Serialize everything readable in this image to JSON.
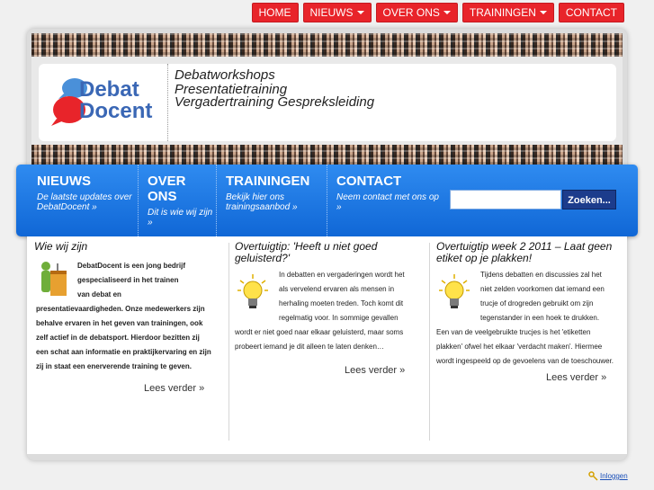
{
  "topnav": {
    "items": [
      {
        "label": "HOME",
        "caret": false
      },
      {
        "label": "NIEUWS",
        "caret": true
      },
      {
        "label": "OVER ONS",
        "caret": true
      },
      {
        "label": "TRAININGEN",
        "caret": true
      },
      {
        "label": "CONTACT",
        "caret": false
      }
    ]
  },
  "header": {
    "logo_word1": "Debat",
    "logo_word2": "Docent",
    "tagline": [
      "Debatworkshops",
      "Presentatietraining",
      "Vergadertraining Gespreksleiding"
    ]
  },
  "bluebar": {
    "items": [
      {
        "title": "NIEUWS",
        "sub": "De laatste updates over DebatDocent »"
      },
      {
        "title": "OVER ONS",
        "sub": "Dit is wie wij zijn »"
      },
      {
        "title": "TRAININGEN",
        "sub": "Bekijk hier ons trainingsaanbod »"
      },
      {
        "title": "CONTACT",
        "sub": "Neem contact met ons op »"
      }
    ],
    "search_button": "Zoeken..."
  },
  "columns": [
    {
      "title": "Wie wij zijn",
      "body_lines": [
        "DebatDocent is een jong bedrijf",
        "gespecialiseerd in het trainen",
        "van debat en",
        "presentatievaardigheden. Onze medewerkers zijn",
        "behalve ervaren in het geven van trainingen, ook",
        "zelf actief in de debatsport. Hierdoor bezitten zij",
        "een schat aan informatie en praktijkervaring en zijn",
        "zij in staat een enerverende training te geven."
      ],
      "more": "Lees verder »"
    },
    {
      "title": "Overtuigtip: 'Heeft u niet goed geluisterd?'",
      "body_lines": [
        "In debatten en vergaderingen wordt het",
        "als vervelend ervaren als mensen in",
        "herhaling moeten treden. Toch komt dit",
        "regelmatig voor. In sommige gevallen",
        "wordt er niet goed naar elkaar geluisterd, maar soms",
        "probeert iemand je dit alleen te laten denken…"
      ],
      "more": "Lees verder »"
    },
    {
      "title": "Overtuigtip week 2 2011 – Laat geen etiket op je plakken!",
      "body_lines": [
        "Tijdens debatten en discussies zal het",
        "niet zelden voorkomen dat iemand een",
        "trucje of drogreden gebruikt om zijn",
        "tegenstander in een hoek te drukken.",
        "Een van de veelgebruikte trucjes is het 'etiketten",
        "plakken' ofwel het elkaar 'verdacht maken'. Hiermee",
        "wordt ingespeeld op de gevoelens van de toeschouwer."
      ],
      "more": "Lees verder »"
    }
  ],
  "footer": {
    "link": "Inloggen"
  }
}
